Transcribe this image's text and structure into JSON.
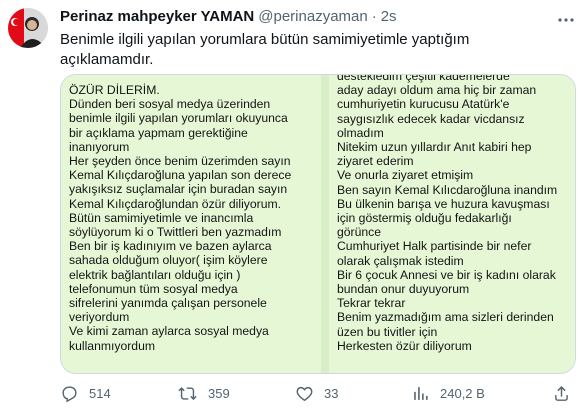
{
  "tweet": {
    "name": "Perinaz mahpeyker YAMAN",
    "handle": "@perinazyaman",
    "separator": "·",
    "time": "2s",
    "text": "Benimle ilgili yapılan yorumlara bütün samimiyetimle yaptığım açıklamamdır."
  },
  "media": {
    "left_lines": [
      "ÖZÜR DİLERİM.",
      "Dünden beri sosyal medya üzerinden",
      "benimle ilgili yapılan yorumları okuyunca",
      "bir açıklama yapmam gerektiğine",
      "inanıyorum",
      "Her şeyden önce benim üzerimden sayın",
      "Kemal Kılıçdaroğluna yapılan son derece",
      "yakışıksız suçlamalar için buradan sayın",
      "Kemal Kılıçdaroğlundan özür diliyorum.",
      "Bütün samimiyetimle ve inancımla",
      "söylüyorum ki o Twittleri ben yazmadım",
      "Ben bir iş kadınıyım ve bazen aylarca",
      "sahada olduğum oluyor( işim köylere",
      "elektrik bağlantıları olduğu için )",
      "telefonumun tüm sosyal medya",
      "sifrelerini yanımda çalışan personele",
      "veriyordum",
      "Ve kimi zaman aylarca sosyal medya",
      "kullanmıyordum"
    ],
    "right_lines": [
      "destekledim çeşitli kademelerde",
      "aday adayı oldum ama hiç bir zaman",
      "cumhuriyetin kurucusu Atatürk'e",
      "saygısızlık edecek kadar vicdansız",
      "olmadım",
      "Nitekim uzun yıllardır Anıt kabiri hep",
      "ziyaret ederim",
      "Ve onurla ziyaret etmişim",
      "Ben sayın Kemal Kılıcdaroğluna inandım",
      "Bu ülkenin barışa ve huzura kavuşması",
      "için göstermiş olduğu fedakarlığı",
      "görünce",
      "Cumhuriyet Halk partisinde bir nefer",
      "olarak çalışmak istedim",
      "Bir 6 çocuk Annesi ve bir iş kadını olarak",
      "bundan onur duyuyorum",
      "Tekrar tekrar",
      "Benim yazmadığım ama sizleri derinden",
      "üzen bu tivitler için",
      "Herkesten özür diliyorum"
    ]
  },
  "actions": {
    "replies": "514",
    "retweets": "359",
    "likes": "33",
    "views": "240,2 B"
  },
  "icons": [
    "avatar-flag",
    "more-icon",
    "reply-icon",
    "retweet-icon",
    "like-icon",
    "views-icon",
    "share-icon"
  ],
  "colors": {
    "text": "#0f1419",
    "muted": "#536471",
    "paper": "#e6f7d6",
    "border": "#cfd9de"
  }
}
